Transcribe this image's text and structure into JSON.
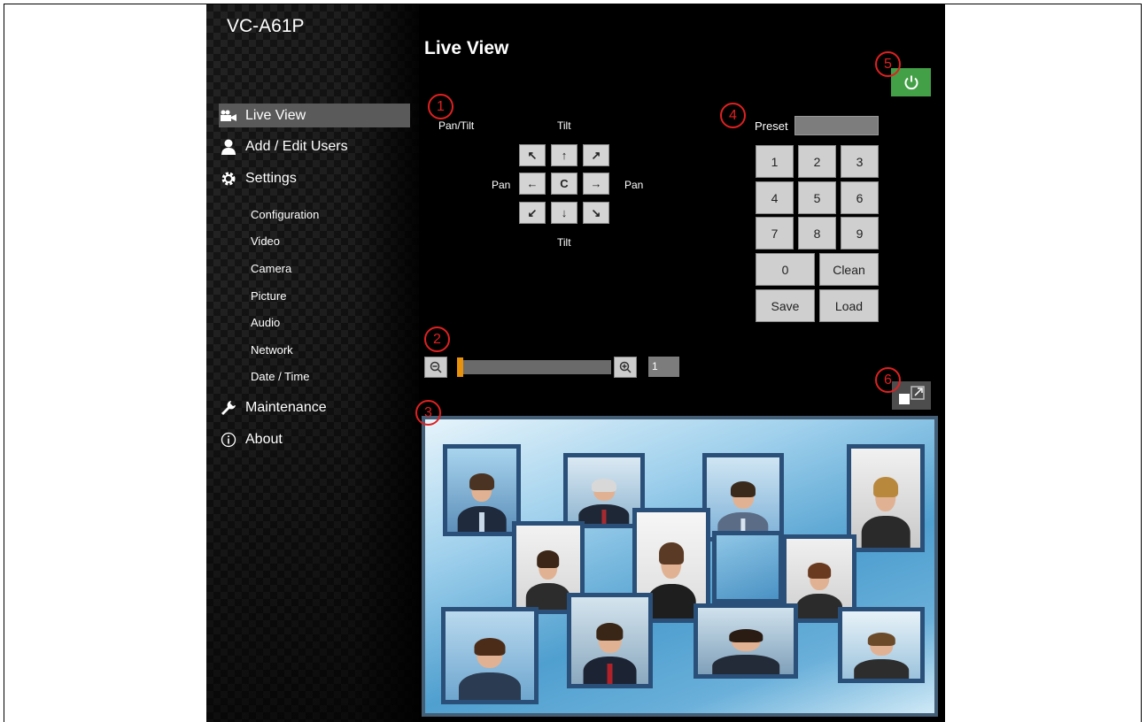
{
  "app": {
    "brand": "VC-A61P"
  },
  "sidebar": {
    "items": [
      {
        "label": "Live View",
        "icon": "camera-icon",
        "active": true
      },
      {
        "label": "Add / Edit Users",
        "icon": "user-icon"
      },
      {
        "label": "Settings",
        "icon": "gear-icon"
      },
      {
        "label": "Maintenance",
        "icon": "wrench-icon"
      },
      {
        "label": "About",
        "icon": "info-icon"
      }
    ],
    "settings_sub": [
      "Configuration",
      "Video",
      "Camera",
      "Picture",
      "Audio",
      "Network",
      "Date / Time"
    ]
  },
  "main": {
    "title": "Live View",
    "pan_tilt": {
      "title": "Pan/Tilt",
      "tilt_label": "Tilt",
      "pan_label": "Pan",
      "buttons": [
        "↖",
        "↑",
        "↗",
        "←",
        "C",
        "→",
        "↙",
        "↓",
        "↘"
      ]
    },
    "preset": {
      "label": "Preset",
      "value": "",
      "keys": [
        "1",
        "2",
        "3",
        "4",
        "5",
        "6",
        "7",
        "8",
        "9"
      ],
      "zero": "0",
      "clean": "Clean",
      "save": "Save",
      "load": "Load"
    },
    "zoom": {
      "value": "1",
      "position": 0.0
    },
    "markers": [
      "1",
      "2",
      "3",
      "4",
      "5",
      "6"
    ]
  },
  "colors": {
    "power_button": "#43a047",
    "slider_thumb": "#e8920c",
    "marker": "#e02020",
    "active_nav": "#5a5a5a"
  }
}
